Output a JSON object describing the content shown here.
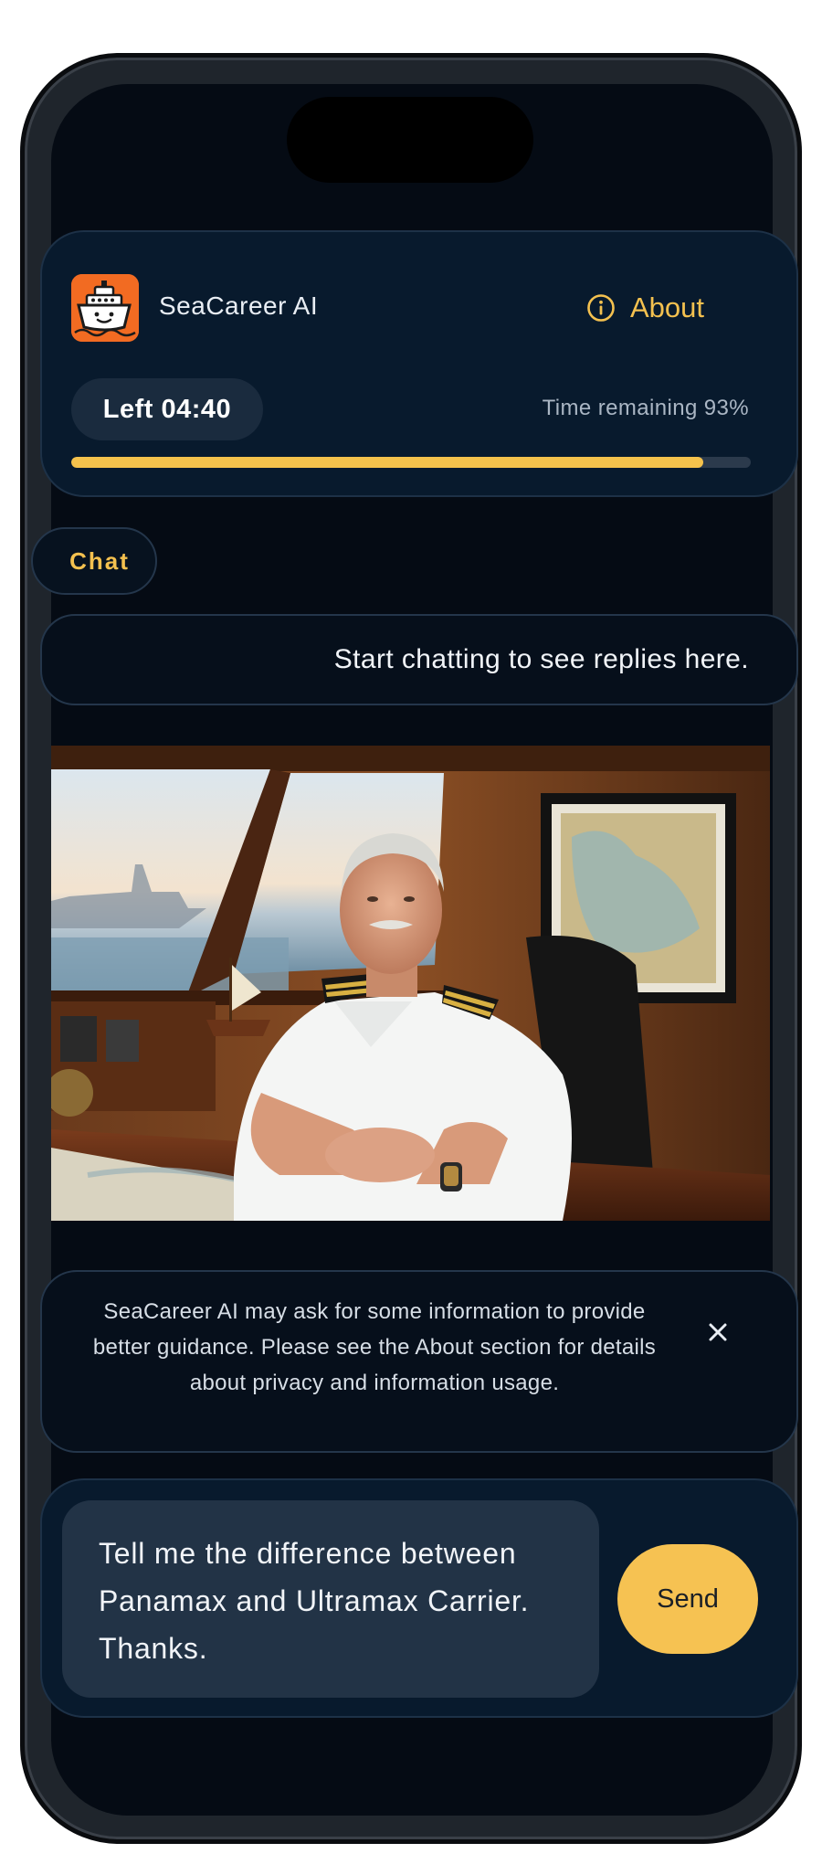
{
  "app": {
    "name": "SeaCareer AI",
    "logo_icon": "ship-mascot-icon",
    "about_label": "About",
    "about_icon": "info-circle-icon"
  },
  "session": {
    "timer_label": "Left 04:40",
    "remaining_text": "Time remaining 93%",
    "remaining_fraction": 0.93
  },
  "tabs": {
    "chat_label": "Chat"
  },
  "chat": {
    "empty_text": "Start chatting to see replies here."
  },
  "notice": {
    "text": "SeaCareer AI may ask for some information to provide better guidance. Please see the About section for details about privacy and information usage.",
    "close_icon": "close-icon"
  },
  "composer": {
    "input_value": "Tell me the difference between Panamax and Ultramax Carrier. Thanks.",
    "send_label": "Send"
  },
  "colors": {
    "accent": "#f5c24c",
    "background": "#050b14",
    "card": "#081a2d",
    "logo": "#f26b22"
  }
}
